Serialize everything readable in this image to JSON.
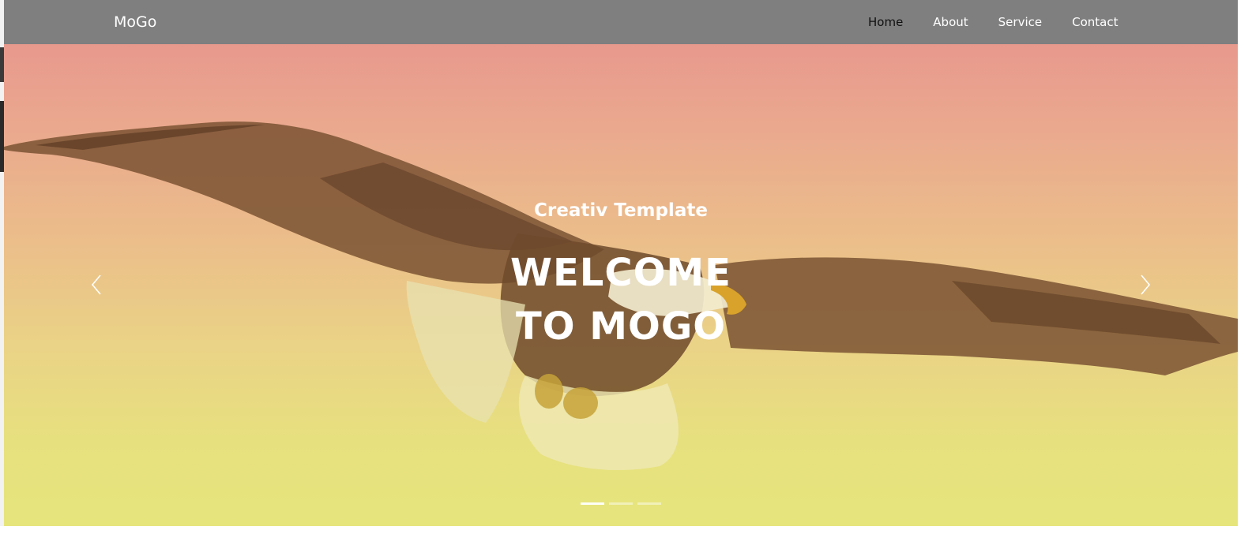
{
  "header": {
    "logo": "MoGo",
    "nav": [
      {
        "label": "Home",
        "active": true
      },
      {
        "label": "About",
        "active": false
      },
      {
        "label": "Service",
        "active": false
      },
      {
        "label": "Contact",
        "active": false
      }
    ]
  },
  "hero": {
    "subtitle": "Creativ Template",
    "title_line1": "WELCOME",
    "title_line2": "TO MOGO",
    "prev_icon": "chevron-left-icon",
    "next_icon": "chevron-right-icon",
    "slides_count": 3,
    "active_slide": 1
  },
  "colors": {
    "header_bg": "#7f7f7f",
    "hero_top": "#e8998d",
    "hero_bottom": "#e6e57c",
    "text": "#ffffff",
    "active_nav": "#111111"
  }
}
